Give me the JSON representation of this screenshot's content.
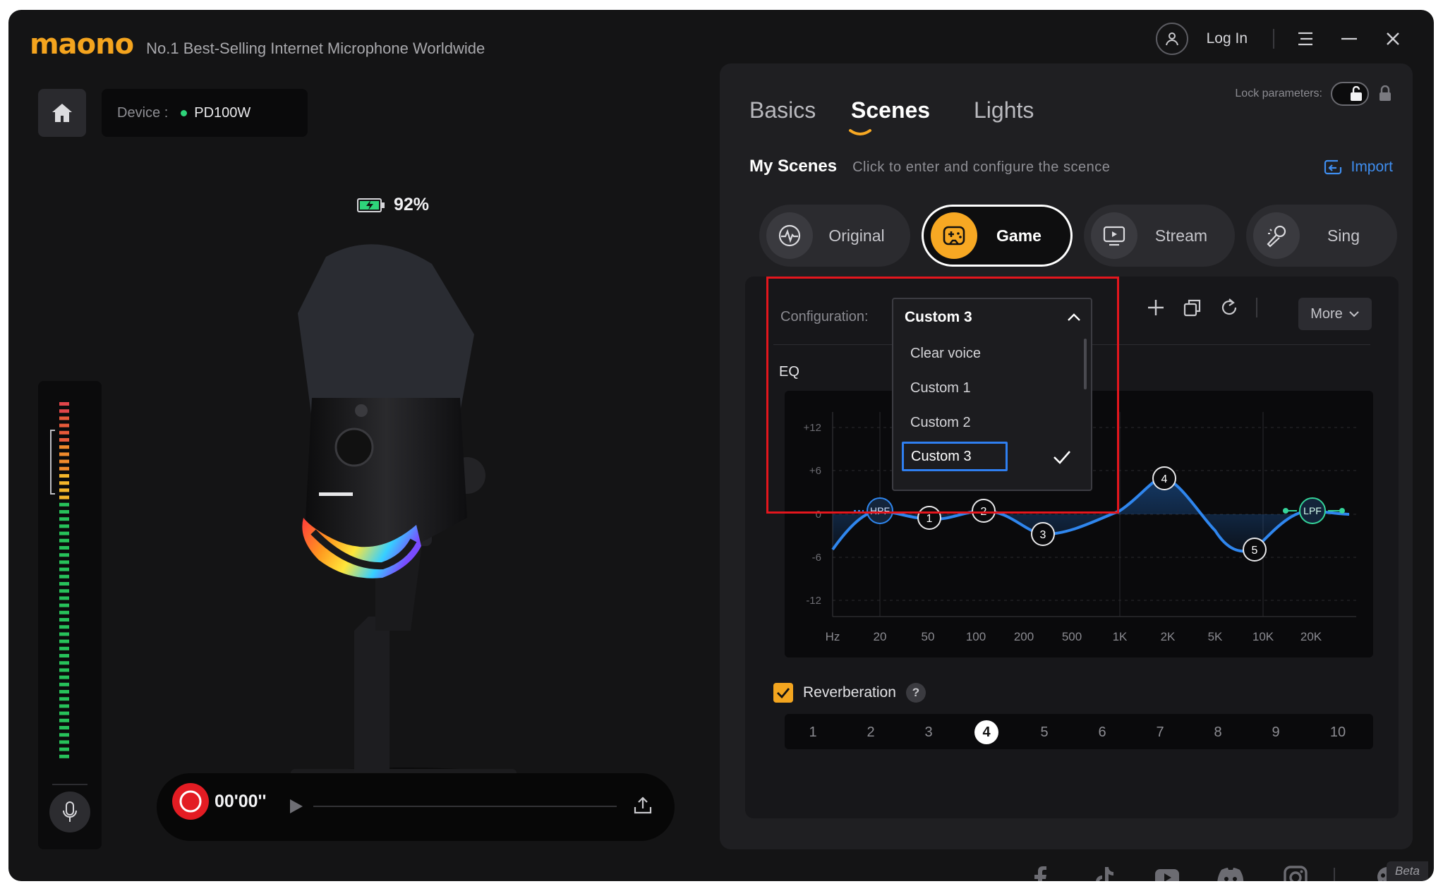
{
  "header": {
    "brand": "maono",
    "tagline": "No.1 Best-Selling Internet Microphone Worldwide",
    "login_label": "Log In"
  },
  "device": {
    "label": "Device :",
    "name": "PD100W",
    "status_color": "#2ed47a"
  },
  "battery": {
    "percent_label": "92%"
  },
  "recorder": {
    "time": "00'00''"
  },
  "tabs": [
    {
      "label": "Basics",
      "active": false
    },
    {
      "label": "Scenes",
      "active": true
    },
    {
      "label": "Lights",
      "active": false
    }
  ],
  "lock": {
    "label": "Lock parameters:"
  },
  "my_scenes": {
    "title": "My Scenes",
    "hint": "Click to enter and configure the scence",
    "import_label": "Import"
  },
  "scenes": [
    {
      "label": "Original",
      "icon": "waveform-icon",
      "active": false
    },
    {
      "label": "Game",
      "icon": "gamepad-icon",
      "active": true
    },
    {
      "label": "Stream",
      "icon": "broadcast-screen-icon",
      "active": false
    },
    {
      "label": "Sing",
      "icon": "karaoke-mic-icon",
      "active": false
    }
  ],
  "configuration": {
    "label": "Configuration:",
    "selected": "Custom 3",
    "options": [
      "Clear voice",
      "Custom 1",
      "Custom 2",
      "Custom 3"
    ],
    "more_label": "More"
  },
  "eq": {
    "label": "EQ",
    "y_ticks": [
      "+12",
      "+6",
      "0",
      "-6",
      "-12"
    ],
    "x_ticks": [
      "Hz",
      "20",
      "50",
      "100",
      "200",
      "500",
      "1K",
      "2K",
      "5K",
      "10K",
      "20K"
    ],
    "filters": {
      "hpf": "HPF",
      "lpf": "LPF"
    },
    "nodes": [
      "1",
      "2",
      "3",
      "4",
      "5"
    ],
    "curve_color": "#2f86ee"
  },
  "reverb": {
    "label": "Reverberation",
    "enabled": true,
    "help": "?",
    "levels": [
      "1",
      "2",
      "3",
      "4",
      "5",
      "6",
      "7",
      "8",
      "9",
      "10"
    ],
    "selected": "4"
  },
  "footer": {
    "social": [
      "facebook-icon",
      "tiktok-icon",
      "youtube-icon",
      "discord-icon",
      "instagram-icon",
      "feedback-icon"
    ],
    "beta_label": "Beta"
  },
  "colors": {
    "accent": "#f7a823",
    "highlight_border": "#e4161d",
    "selection_blue": "#2f7ff0"
  }
}
